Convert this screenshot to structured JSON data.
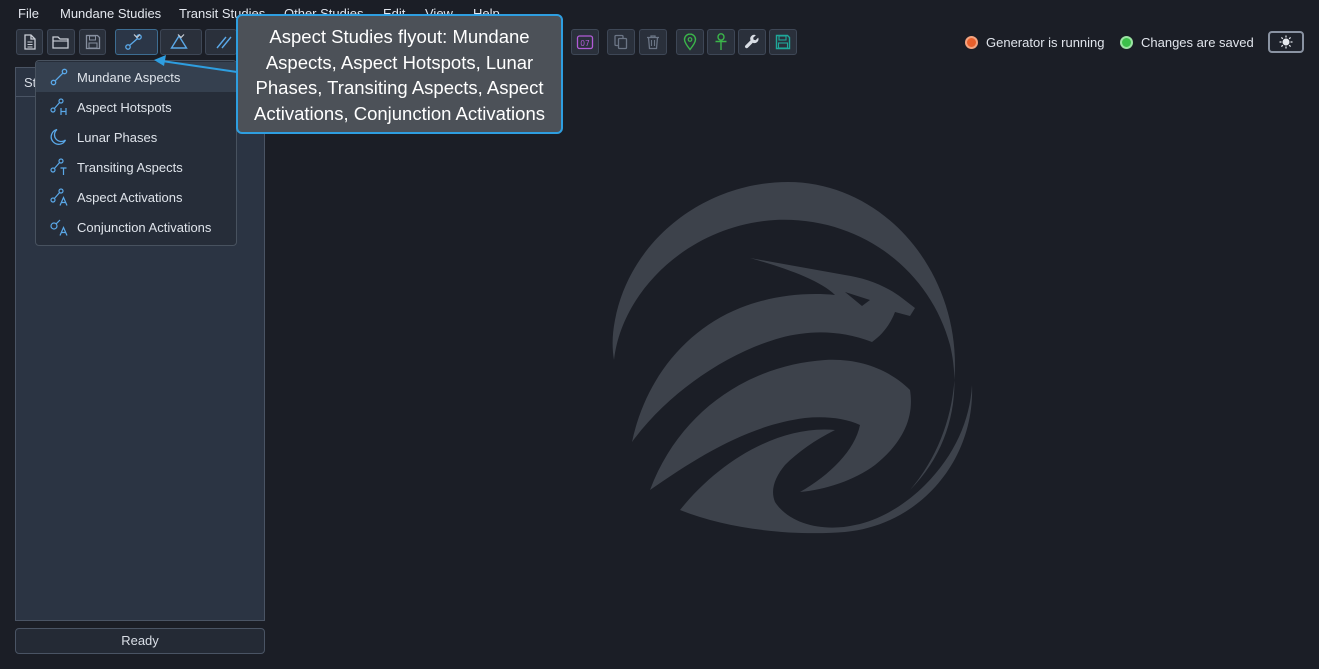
{
  "menu": [
    "File",
    "Mundane Studies",
    "Transit Studies",
    "Other Studies",
    "Edit",
    "View",
    "Help"
  ],
  "icons": {
    "new": "new-file-icon",
    "open": "open-folder-icon",
    "save": "save-disk-icon",
    "aspect": "aspect-node-icon",
    "triangle": "triangle-icon",
    "parallel": "parallel-lines-icon",
    "calendar": "calendar-icon",
    "copy": "copy-icon",
    "delete": "trash-icon",
    "location": "location-pin-icon",
    "ankh": "ankh-icon",
    "wrench": "wrench-icon",
    "save_green": "save-green-icon"
  },
  "toolbar": {
    "calendar_label": "07"
  },
  "status": {
    "generator": "Generator is running",
    "generator_color": "#e8602c",
    "saved": "Changes are saved",
    "saved_color": "#3cbf4a"
  },
  "panel": {
    "header": "St",
    "footer": "Ready"
  },
  "flyout": {
    "items": [
      {
        "label": "Mundane Aspects",
        "icon": "mundane-aspects-icon",
        "active": true
      },
      {
        "label": "Aspect Hotspots",
        "icon": "aspect-hotspots-icon"
      },
      {
        "label": "Lunar Phases",
        "icon": "lunar-phases-icon"
      },
      {
        "label": "Transiting Aspects",
        "icon": "transiting-aspects-icon"
      },
      {
        "label": "Aspect Activations",
        "icon": "aspect-activations-icon"
      },
      {
        "label": "Conjunction Activations",
        "icon": "conjunction-activations-icon"
      }
    ]
  },
  "callout": {
    "lines": [
      "Aspect Studies flyout: Mundane",
      "Aspects, Aspect Hotspots, Lunar",
      "Phases, Transiting Aspects, Aspect",
      "Activations, Conjunction Activations"
    ]
  },
  "colors": {
    "accent": "#2e9ee0",
    "background": "#1b1e26",
    "panel": "#2b3443"
  }
}
